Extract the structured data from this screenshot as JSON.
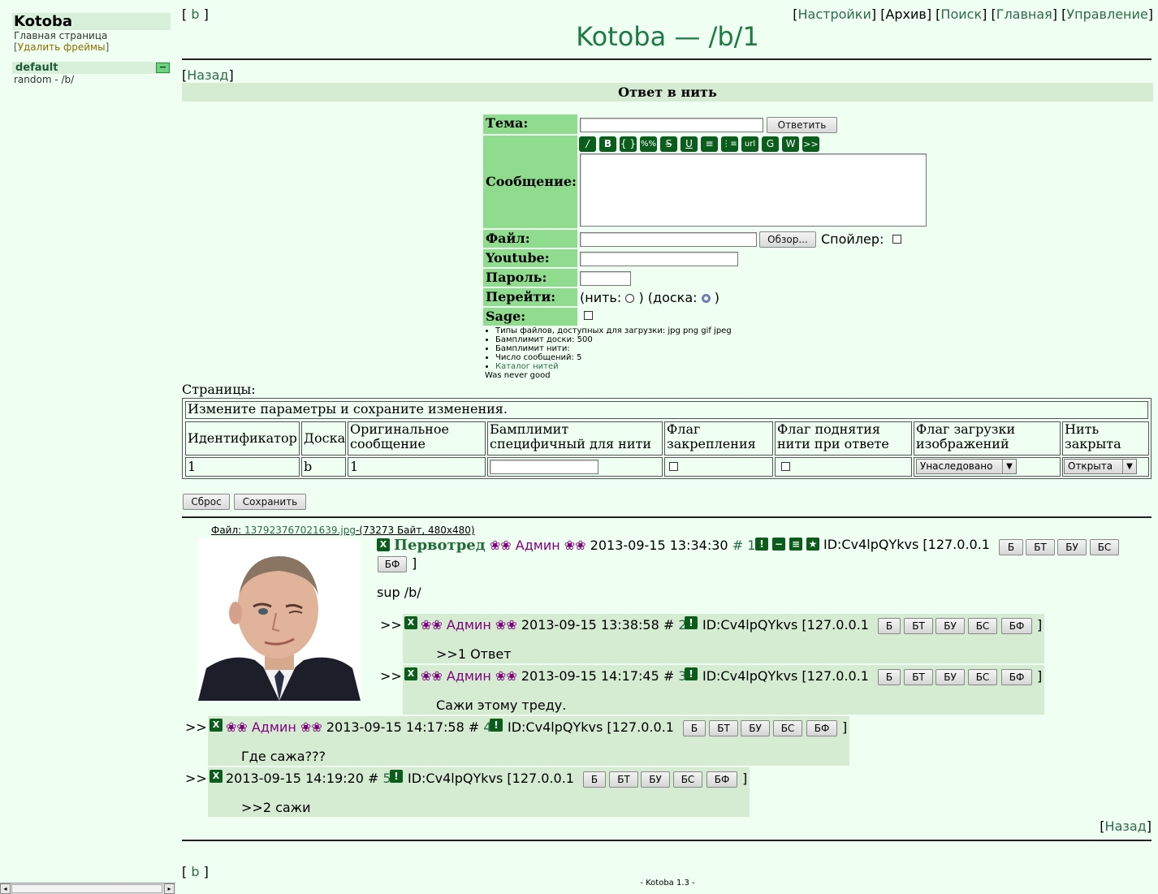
{
  "left": {
    "title": "Kotoba",
    "home": "Главная страница",
    "remove_frames": "Удалить фреймы",
    "section": "default",
    "collapse": "−",
    "board": "random - /b/"
  },
  "nav": {
    "board_link": "b",
    "settings": "Настройки",
    "archive": "Архив",
    "search": "Поиск",
    "main": "Главная",
    "manage": "Управление"
  },
  "page_title": "Kotoba — /b/1",
  "back": "Назад",
  "reply_head": "Ответ в нить",
  "form": {
    "subject_label": "Тема:",
    "reply_button": "Ответить",
    "message_label": "Сообщение:",
    "markup_buttons": [
      "/",
      "B",
      "{ }",
      "%%",
      "S",
      "U",
      "≡",
      "⋮≡",
      "url",
      "G",
      "W",
      ">>"
    ],
    "file_label": "Файл:",
    "browse_button": "Обзор...",
    "spoiler_label": "Спойлер:",
    "youtube_label": "Youtube:",
    "password_label": "Пароль:",
    "goto_label": "Перейти:",
    "goto_thread": "(нить:",
    "goto_board": ") (доска:",
    "goto_close": ")",
    "sage_label": "Sage:"
  },
  "rules": {
    "items": [
      "Типы файлов, доступных для загрузки: jpg png gif jpeg",
      "Бамплимит доски: 500",
      "Бамплимит нити:",
      "Число сообщений: 5"
    ],
    "catalog": "Каталог нитей",
    "footer": "Was never good"
  },
  "pages_label": "Страницы:",
  "settings": {
    "caption": "Измените параметры и сохраните изменения.",
    "headers": {
      "id": "Идентификатор",
      "board": "Доска",
      "orig": "Оригинальное сообщение",
      "bump": "Бамплимит специфичный для нити",
      "sticky": "Флаг закрепления",
      "sage": "Флаг поднятия нити при ответе",
      "images": "Флаг загрузки изображений",
      "closed": "Нить закрыта"
    },
    "row": {
      "id": "1",
      "board": "b",
      "orig": "1",
      "images": "Унаследовано",
      "closed": "Открыта"
    },
    "reset": "Сброс",
    "save": "Сохранить"
  },
  "op": {
    "file_label": "Файл:",
    "file_name": "137923767021639.jpg",
    "file_info": "-(73273 Байт, 480x480)",
    "subject": "Первотред",
    "name": "❀❀ Админ ❀❀",
    "date": "2013-09-15 13:34:30",
    "hash": "#",
    "num": "1",
    "id": "ID:Cv4lpQYkvs",
    "ip": "[127.0.0.1",
    "close": "]",
    "text": "sup /b/"
  },
  "mod_buttons": [
    "Б",
    "БТ",
    "БУ",
    "БС",
    "БФ"
  ],
  "replies": [
    {
      "name": "❀❀ Админ ❀❀",
      "date": "2013-09-15 13:38:58",
      "num": "2",
      "id": "ID:Cv4lpQYkvs",
      "ip": "[127.0.0.1",
      "text": ">>1 Ответ"
    },
    {
      "name": "❀❀ Админ ❀❀",
      "date": "2013-09-15 14:17:45",
      "num": "3",
      "id": "ID:Cv4lpQYkvs",
      "ip": "[127.0.0.1",
      "text": "Сажи этому треду."
    },
    {
      "name": "❀❀ Админ ❀❀",
      "date": "2013-09-15 14:17:58",
      "num": "4",
      "id": "ID:Cv4lpQYkvs",
      "ip": "[127.0.0.1",
      "text": "Где сажа???"
    },
    {
      "name": "",
      "date": "2013-09-15 14:19:20",
      "num": "5",
      "id": "ID:Cv4lpQYkvs",
      "ip": "[127.0.0.1",
      "text": ">>2 сажи"
    }
  ],
  "reply_arrow": ">>",
  "footer": "- Kotoba 1.3 -"
}
